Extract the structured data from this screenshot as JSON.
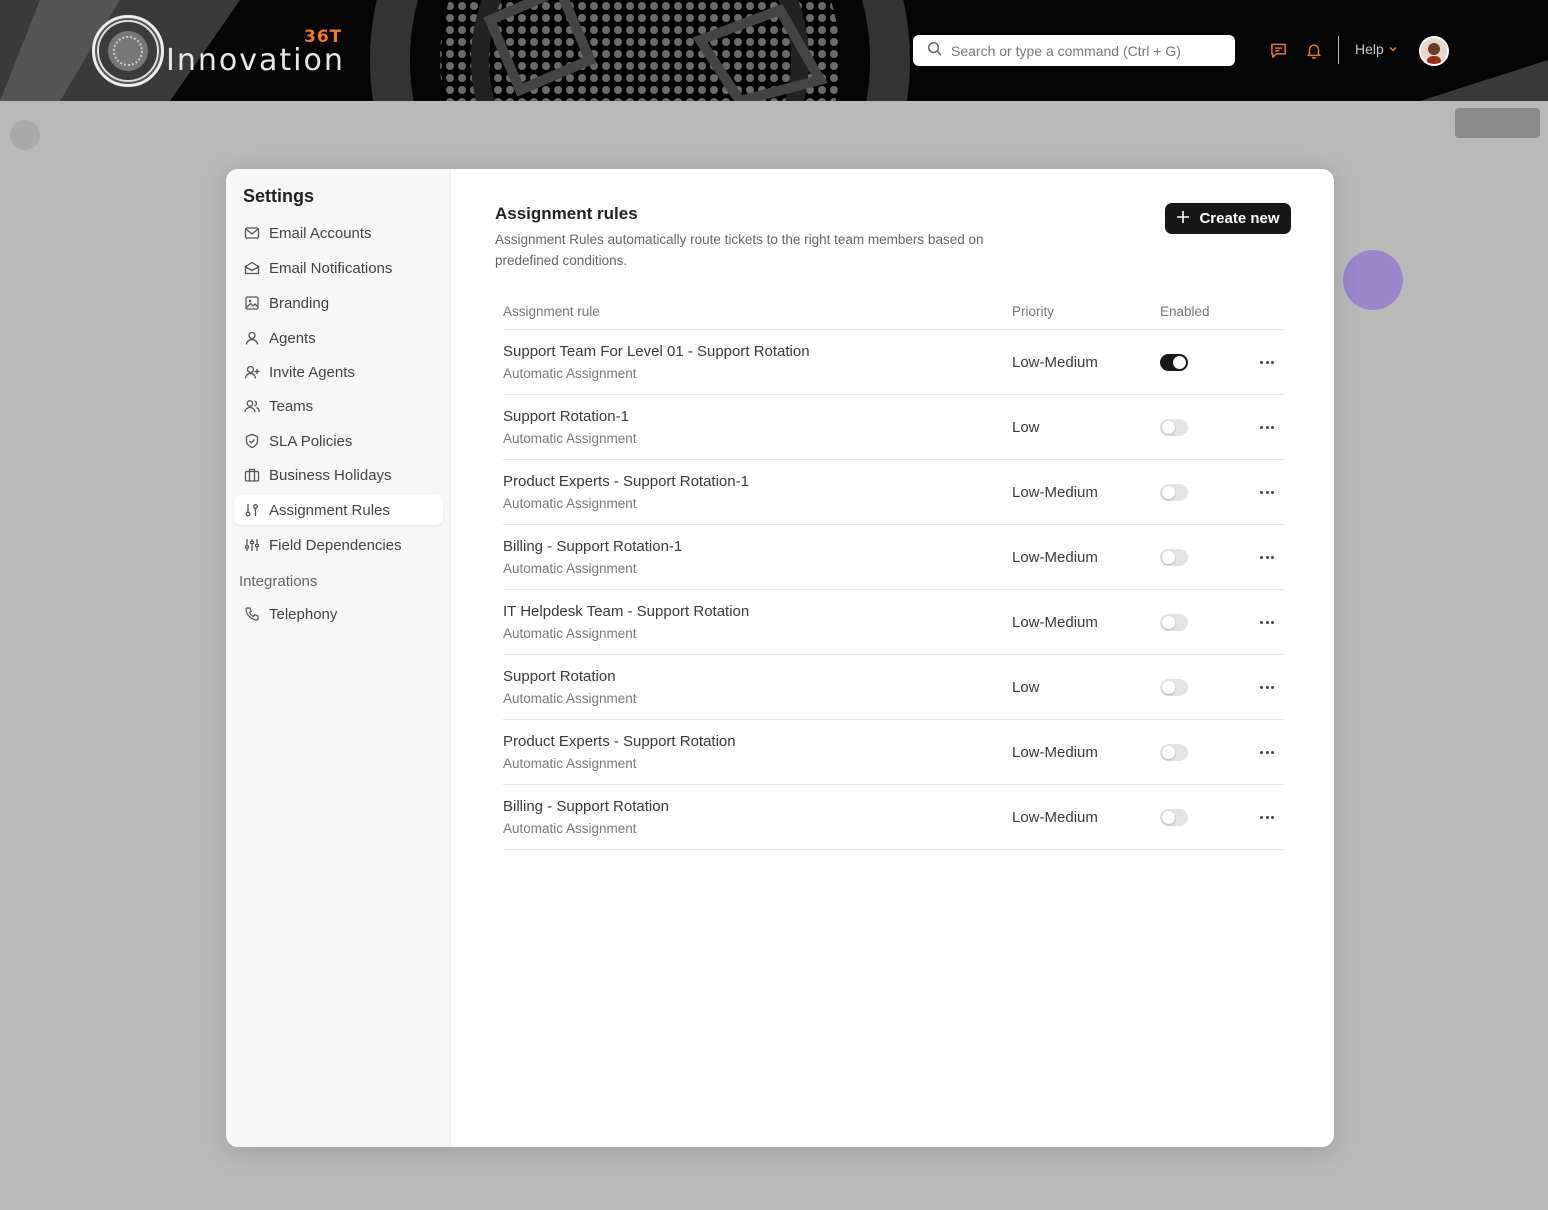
{
  "brand": {
    "logo_text": "Innovation",
    "logo_sub": "36T",
    "accent": "#f07a1c"
  },
  "search": {
    "placeholder": "Search or type a command (Ctrl + G)"
  },
  "header": {
    "help_label": "Help",
    "icons": [
      "chat-icon",
      "bell-icon",
      "chevron-down-icon",
      "avatar"
    ]
  },
  "sidebar": {
    "title": "Settings",
    "items": [
      {
        "label": "Email Accounts",
        "icon": "mail-icon"
      },
      {
        "label": "Email Notifications",
        "icon": "mail-open-icon"
      },
      {
        "label": "Branding",
        "icon": "image-icon"
      },
      {
        "label": "Agents",
        "icon": "user-icon"
      },
      {
        "label": "Invite Agents",
        "icon": "user-plus-icon"
      },
      {
        "label": "Teams",
        "icon": "users-icon"
      },
      {
        "label": "SLA Policies",
        "icon": "shield-icon"
      },
      {
        "label": "Business Holidays",
        "icon": "briefcase-icon"
      },
      {
        "label": "Assignment Rules",
        "icon": "assignment-icon",
        "active": true
      },
      {
        "label": "Field Dependencies",
        "icon": "sliders-icon"
      }
    ],
    "group_label": "Integrations",
    "integrations": [
      {
        "label": "Telephony",
        "icon": "phone-icon"
      }
    ]
  },
  "main": {
    "title": "Assignment rules",
    "description": "Assignment Rules automatically route tickets to the right team members based on predefined conditions.",
    "create_label": "Create new",
    "columns": {
      "rule": "Assignment rule",
      "priority": "Priority",
      "enabled": "Enabled"
    },
    "rows": [
      {
        "name": "Support Team For Level 01 - Support Rotation",
        "type": "Automatic Assignment",
        "priority": "Low-Medium",
        "enabled": true
      },
      {
        "name": "Support Rotation-1",
        "type": "Automatic Assignment",
        "priority": "Low",
        "enabled": false
      },
      {
        "name": "Product Experts - Support Rotation-1",
        "type": "Automatic Assignment",
        "priority": "Low-Medium",
        "enabled": false
      },
      {
        "name": "Billing - Support Rotation-1",
        "type": "Automatic Assignment",
        "priority": "Low-Medium",
        "enabled": false
      },
      {
        "name": "IT Helpdesk Team - Support Rotation",
        "type": "Automatic Assignment",
        "priority": "Low-Medium",
        "enabled": false
      },
      {
        "name": "Support Rotation",
        "type": "Automatic Assignment",
        "priority": "Low",
        "enabled": false
      },
      {
        "name": "Product Experts - Support Rotation",
        "type": "Automatic Assignment",
        "priority": "Low-Medium",
        "enabled": false
      },
      {
        "name": "Billing - Support Rotation",
        "type": "Automatic Assignment",
        "priority": "Low-Medium",
        "enabled": false
      }
    ]
  }
}
